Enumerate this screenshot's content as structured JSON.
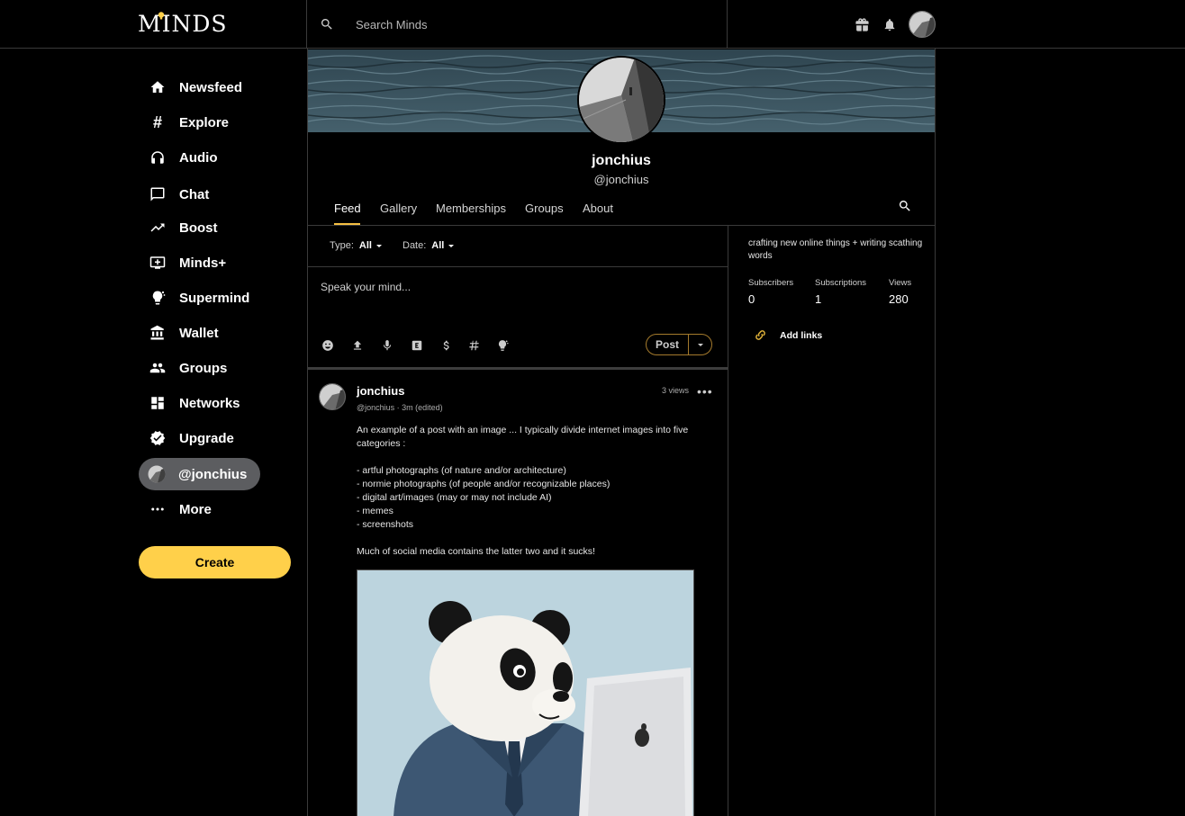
{
  "brand": {
    "name": "MINDS"
  },
  "search": {
    "placeholder": "Search Minds"
  },
  "sidebar": {
    "items": [
      {
        "label": "Newsfeed",
        "icon": "home-icon"
      },
      {
        "label": "Explore",
        "icon": "hash-icon"
      },
      {
        "label": "Audio",
        "icon": "headphones-icon"
      },
      {
        "label": "Chat",
        "icon": "chat-icon"
      },
      {
        "label": "Boost",
        "icon": "trending-icon"
      },
      {
        "label": "Minds+",
        "icon": "add-to-queue-icon"
      },
      {
        "label": "Supermind",
        "icon": "lightbulb-icon"
      },
      {
        "label": "Wallet",
        "icon": "bank-icon"
      },
      {
        "label": "Groups",
        "icon": "people-icon"
      },
      {
        "label": "Networks",
        "icon": "dashboard-icon"
      },
      {
        "label": "Upgrade",
        "icon": "verified-icon"
      },
      {
        "label": "@jonchius",
        "icon": "avatar-icon",
        "active": true
      },
      {
        "label": "More",
        "icon": "more-horizontal-icon"
      }
    ],
    "create_label": "Create"
  },
  "profile": {
    "username": "jonchius",
    "handle": "@jonchius",
    "tabs": [
      "Feed",
      "Gallery",
      "Memberships",
      "Groups",
      "About"
    ],
    "active_tab": "Feed",
    "bio": "crafting new online things + writing scathing words",
    "stats": [
      {
        "label": "Subscribers",
        "value": "0"
      },
      {
        "label": "Subscriptions",
        "value": "1"
      },
      {
        "label": "Views",
        "value": "280"
      }
    ],
    "add_links_label": "Add links"
  },
  "filters": {
    "type_label": "Type:",
    "type_value": "All",
    "date_label": "Date:",
    "date_value": "All"
  },
  "composer": {
    "placeholder": "Speak your mind...",
    "post_label": "Post"
  },
  "post": {
    "author": "jonchius",
    "meta": "@jonchius · 3m (edited)",
    "views": "3 views",
    "text": "An example of a post with an image ... I typically divide internet images into five categories :\n\n- artful photographs (of nature and/or architecture)\n- normie photographs (of people and/or recognizable places)\n- digital art/images (may or may not include AI)\n- memes\n- screenshots\n\nMuch of social media contains the latter two and it sucks!"
  },
  "colors": {
    "accent": "#ffd04a",
    "active_nav": "#5c5d60",
    "tab_underline": "#f5c043",
    "link_icon": "#e0b23a"
  }
}
